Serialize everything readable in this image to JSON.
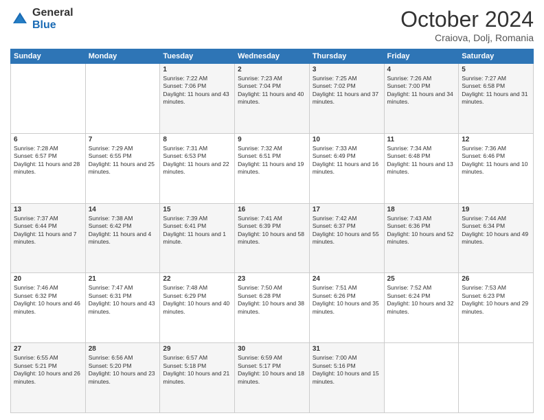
{
  "header": {
    "logo_general": "General",
    "logo_blue": "Blue",
    "month_title": "October 2024",
    "location": "Craiova, Dolj, Romania"
  },
  "days_of_week": [
    "Sunday",
    "Monday",
    "Tuesday",
    "Wednesday",
    "Thursday",
    "Friday",
    "Saturday"
  ],
  "weeks": [
    [
      {
        "day": "",
        "sunrise": "",
        "sunset": "",
        "daylight": ""
      },
      {
        "day": "",
        "sunrise": "",
        "sunset": "",
        "daylight": ""
      },
      {
        "day": "1",
        "sunrise": "Sunrise: 7:22 AM",
        "sunset": "Sunset: 7:06 PM",
        "daylight": "Daylight: 11 hours and 43 minutes."
      },
      {
        "day": "2",
        "sunrise": "Sunrise: 7:23 AM",
        "sunset": "Sunset: 7:04 PM",
        "daylight": "Daylight: 11 hours and 40 minutes."
      },
      {
        "day": "3",
        "sunrise": "Sunrise: 7:25 AM",
        "sunset": "Sunset: 7:02 PM",
        "daylight": "Daylight: 11 hours and 37 minutes."
      },
      {
        "day": "4",
        "sunrise": "Sunrise: 7:26 AM",
        "sunset": "Sunset: 7:00 PM",
        "daylight": "Daylight: 11 hours and 34 minutes."
      },
      {
        "day": "5",
        "sunrise": "Sunrise: 7:27 AM",
        "sunset": "Sunset: 6:58 PM",
        "daylight": "Daylight: 11 hours and 31 minutes."
      }
    ],
    [
      {
        "day": "6",
        "sunrise": "Sunrise: 7:28 AM",
        "sunset": "Sunset: 6:57 PM",
        "daylight": "Daylight: 11 hours and 28 minutes."
      },
      {
        "day": "7",
        "sunrise": "Sunrise: 7:29 AM",
        "sunset": "Sunset: 6:55 PM",
        "daylight": "Daylight: 11 hours and 25 minutes."
      },
      {
        "day": "8",
        "sunrise": "Sunrise: 7:31 AM",
        "sunset": "Sunset: 6:53 PM",
        "daylight": "Daylight: 11 hours and 22 minutes."
      },
      {
        "day": "9",
        "sunrise": "Sunrise: 7:32 AM",
        "sunset": "Sunset: 6:51 PM",
        "daylight": "Daylight: 11 hours and 19 minutes."
      },
      {
        "day": "10",
        "sunrise": "Sunrise: 7:33 AM",
        "sunset": "Sunset: 6:49 PM",
        "daylight": "Daylight: 11 hours and 16 minutes."
      },
      {
        "day": "11",
        "sunrise": "Sunrise: 7:34 AM",
        "sunset": "Sunset: 6:48 PM",
        "daylight": "Daylight: 11 hours and 13 minutes."
      },
      {
        "day": "12",
        "sunrise": "Sunrise: 7:36 AM",
        "sunset": "Sunset: 6:46 PM",
        "daylight": "Daylight: 11 hours and 10 minutes."
      }
    ],
    [
      {
        "day": "13",
        "sunrise": "Sunrise: 7:37 AM",
        "sunset": "Sunset: 6:44 PM",
        "daylight": "Daylight: 11 hours and 7 minutes."
      },
      {
        "day": "14",
        "sunrise": "Sunrise: 7:38 AM",
        "sunset": "Sunset: 6:42 PM",
        "daylight": "Daylight: 11 hours and 4 minutes."
      },
      {
        "day": "15",
        "sunrise": "Sunrise: 7:39 AM",
        "sunset": "Sunset: 6:41 PM",
        "daylight": "Daylight: 11 hours and 1 minute."
      },
      {
        "day": "16",
        "sunrise": "Sunrise: 7:41 AM",
        "sunset": "Sunset: 6:39 PM",
        "daylight": "Daylight: 10 hours and 58 minutes."
      },
      {
        "day": "17",
        "sunrise": "Sunrise: 7:42 AM",
        "sunset": "Sunset: 6:37 PM",
        "daylight": "Daylight: 10 hours and 55 minutes."
      },
      {
        "day": "18",
        "sunrise": "Sunrise: 7:43 AM",
        "sunset": "Sunset: 6:36 PM",
        "daylight": "Daylight: 10 hours and 52 minutes."
      },
      {
        "day": "19",
        "sunrise": "Sunrise: 7:44 AM",
        "sunset": "Sunset: 6:34 PM",
        "daylight": "Daylight: 10 hours and 49 minutes."
      }
    ],
    [
      {
        "day": "20",
        "sunrise": "Sunrise: 7:46 AM",
        "sunset": "Sunset: 6:32 PM",
        "daylight": "Daylight: 10 hours and 46 minutes."
      },
      {
        "day": "21",
        "sunrise": "Sunrise: 7:47 AM",
        "sunset": "Sunset: 6:31 PM",
        "daylight": "Daylight: 10 hours and 43 minutes."
      },
      {
        "day": "22",
        "sunrise": "Sunrise: 7:48 AM",
        "sunset": "Sunset: 6:29 PM",
        "daylight": "Daylight: 10 hours and 40 minutes."
      },
      {
        "day": "23",
        "sunrise": "Sunrise: 7:50 AM",
        "sunset": "Sunset: 6:28 PM",
        "daylight": "Daylight: 10 hours and 38 minutes."
      },
      {
        "day": "24",
        "sunrise": "Sunrise: 7:51 AM",
        "sunset": "Sunset: 6:26 PM",
        "daylight": "Daylight: 10 hours and 35 minutes."
      },
      {
        "day": "25",
        "sunrise": "Sunrise: 7:52 AM",
        "sunset": "Sunset: 6:24 PM",
        "daylight": "Daylight: 10 hours and 32 minutes."
      },
      {
        "day": "26",
        "sunrise": "Sunrise: 7:53 AM",
        "sunset": "Sunset: 6:23 PM",
        "daylight": "Daylight: 10 hours and 29 minutes."
      }
    ],
    [
      {
        "day": "27",
        "sunrise": "Sunrise: 6:55 AM",
        "sunset": "Sunset: 5:21 PM",
        "daylight": "Daylight: 10 hours and 26 minutes."
      },
      {
        "day": "28",
        "sunrise": "Sunrise: 6:56 AM",
        "sunset": "Sunset: 5:20 PM",
        "daylight": "Daylight: 10 hours and 23 minutes."
      },
      {
        "day": "29",
        "sunrise": "Sunrise: 6:57 AM",
        "sunset": "Sunset: 5:18 PM",
        "daylight": "Daylight: 10 hours and 21 minutes."
      },
      {
        "day": "30",
        "sunrise": "Sunrise: 6:59 AM",
        "sunset": "Sunset: 5:17 PM",
        "daylight": "Daylight: 10 hours and 18 minutes."
      },
      {
        "day": "31",
        "sunrise": "Sunrise: 7:00 AM",
        "sunset": "Sunset: 5:16 PM",
        "daylight": "Daylight: 10 hours and 15 minutes."
      },
      {
        "day": "",
        "sunrise": "",
        "sunset": "",
        "daylight": ""
      },
      {
        "day": "",
        "sunrise": "",
        "sunset": "",
        "daylight": ""
      }
    ]
  ]
}
